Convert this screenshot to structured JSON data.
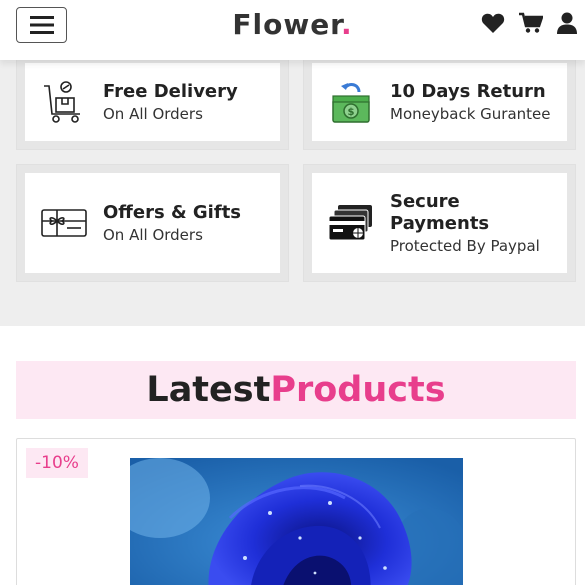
{
  "header": {
    "logo_text": "Flower",
    "logo_dot": ".",
    "icons": [
      "menu-icon",
      "heart-icon",
      "cart-icon",
      "user-icon"
    ],
    "accent": "#e83e8c"
  },
  "features": [
    {
      "title": "Free Delivery",
      "subtitle": "On All Orders",
      "icon": "delivery-cart-icon"
    },
    {
      "title": "10 Days Return",
      "subtitle": "Moneyback Gurantee",
      "icon": "money-return-icon"
    },
    {
      "title": "Offers & Gifts",
      "subtitle": "On All Orders",
      "icon": "gift-card-icon"
    },
    {
      "title": "Secure Payments",
      "subtitle": "Protected By Paypal",
      "icon": "credit-cards-icon"
    }
  ],
  "latest": {
    "word1": "Latest",
    "word2": "Products"
  },
  "product": {
    "discount": "-10%",
    "image": "blue-rose"
  }
}
